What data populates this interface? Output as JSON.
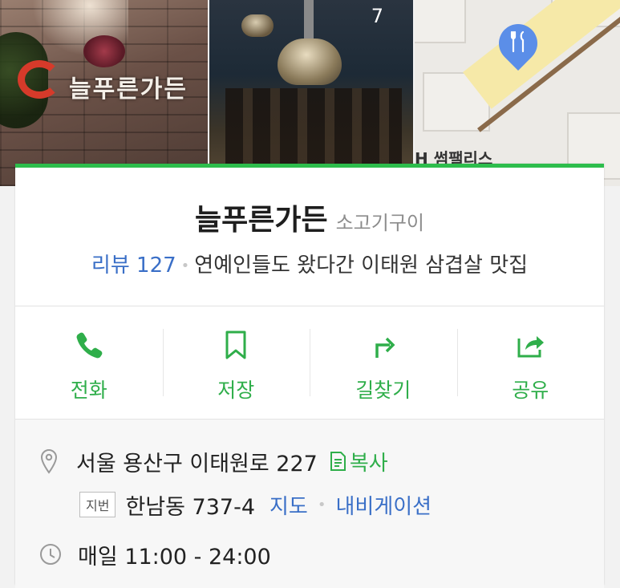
{
  "photos": {
    "photo1_sign": "늘푸른가든",
    "photo_count": "7",
    "map_label": "H 썸팰리스",
    "map_pin_icon": "restaurant-pin-icon"
  },
  "place": {
    "name": "늘푸른가든",
    "category": "소고기구이",
    "review_label": "리뷰 127",
    "description": "연예인들도 왔다간 이태원 삼겹살 맛집"
  },
  "actions": [
    {
      "label": "전화",
      "icon": "phone-icon"
    },
    {
      "label": "저장",
      "icon": "bookmark-icon"
    },
    {
      "label": "길찾기",
      "icon": "directions-icon"
    },
    {
      "label": "공유",
      "icon": "share-icon"
    }
  ],
  "info": {
    "address": "서울 용산구 이태원로 227",
    "copy_label": "복사",
    "jibun_badge": "지번",
    "jibun_address": "한남동 737-4",
    "map_link": "지도",
    "nav_link": "내비게이션",
    "hours": "매일 11:00 - 24:00"
  },
  "colors": {
    "accent_green": "#2fae4a",
    "link_blue": "#3a6fc7",
    "pin_blue": "#5b8ee8"
  }
}
